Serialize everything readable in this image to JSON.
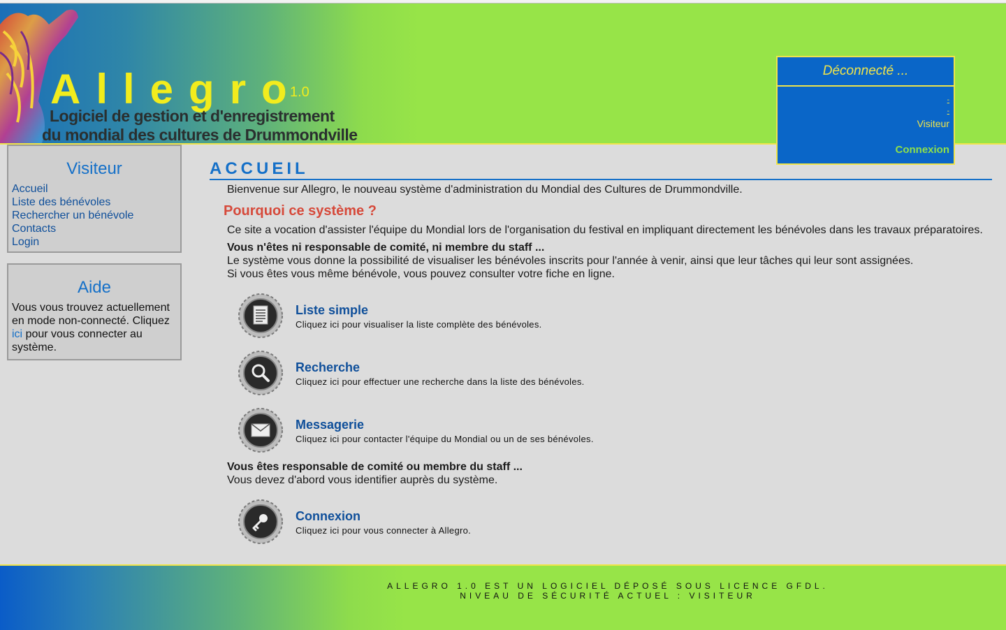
{
  "header": {
    "app_title": "Allegro",
    "app_version": "1.0",
    "subtitle_line1": "Logiciel de gestion et d'enregistrement",
    "subtitle_line2": "du mondial des cultures de Drummondville",
    "colors": {
      "header_start": "#1a6fb8",
      "header_end": "#97e448",
      "accent_yellow": "#f0e44a"
    }
  },
  "status": {
    "title": "Déconnecté ...",
    "dash1": "-",
    "dash2": "-",
    "role": "Visiteur",
    "login_link": "Connexion"
  },
  "sidebar": {
    "menu_title": "Visiteur",
    "items": [
      {
        "label": "Accueil"
      },
      {
        "label": "Liste des bénévoles"
      },
      {
        "label": "Rechercher un bénévole"
      },
      {
        "label": "Contacts"
      },
      {
        "label": "Login"
      }
    ],
    "help_title": "Aide",
    "help_text_before": "Vous vous trouvez actuellement en mode non-connecté. Cliquez",
    "help_link": "ici",
    "help_text_after": "pour vous connecter au système."
  },
  "main": {
    "title": "ACCUEIL",
    "intro": "Bienvenue sur Allegro, le nouveau système d'administration du Mondial des Cultures de Drummondville.",
    "why_heading": "Pourquoi ce système ?",
    "why_text": "Ce site a vocation d'assister l'équipe du Mondial lors de l'organisation du festival en impliquant directement les bénévoles dans les travaux préparatoires.",
    "visitor_heading": "Vous n'êtes ni responsable de comité, ni membre du staff ...",
    "visitor_line1": "Le système vous donne la possibilité de visualiser les bénévoles inscrits pour l'année à venir, ainsi que leur tâches qui leur sont assignées.",
    "visitor_line2": "Si vous êtes vous même bénévole, vous pouvez consulter votre fiche en ligne.",
    "features": [
      {
        "icon": "document-list-icon",
        "title": "Liste simple",
        "desc": "Cliquez ici pour visualiser la liste complète des bénévoles."
      },
      {
        "icon": "magnifier-icon",
        "title": "Recherche",
        "desc": "Cliquez ici pour effectuer une recherche dans la liste des bénévoles."
      },
      {
        "icon": "envelope-icon",
        "title": "Messagerie",
        "desc": "Cliquez ici pour contacter l'équipe du Mondial ou un de ses bénévoles."
      }
    ],
    "staff_heading": "Vous êtes responsable de comité ou membre du staff ...",
    "staff_text": "Vous devez d'abord vous identifier auprès du système.",
    "login_feature": {
      "icon": "key-icon",
      "title": "Connexion",
      "desc": "Cliquez ici pour vous connecter à Allegro."
    }
  },
  "footer": {
    "line1": "ALLEGRO 1.0 EST UN LOGICIEL DÉPOSÉ SOUS LICENCE GFDL.",
    "line2": "NIVEAU DE SÉCURITÉ ACTUEL : VISITEUR"
  }
}
